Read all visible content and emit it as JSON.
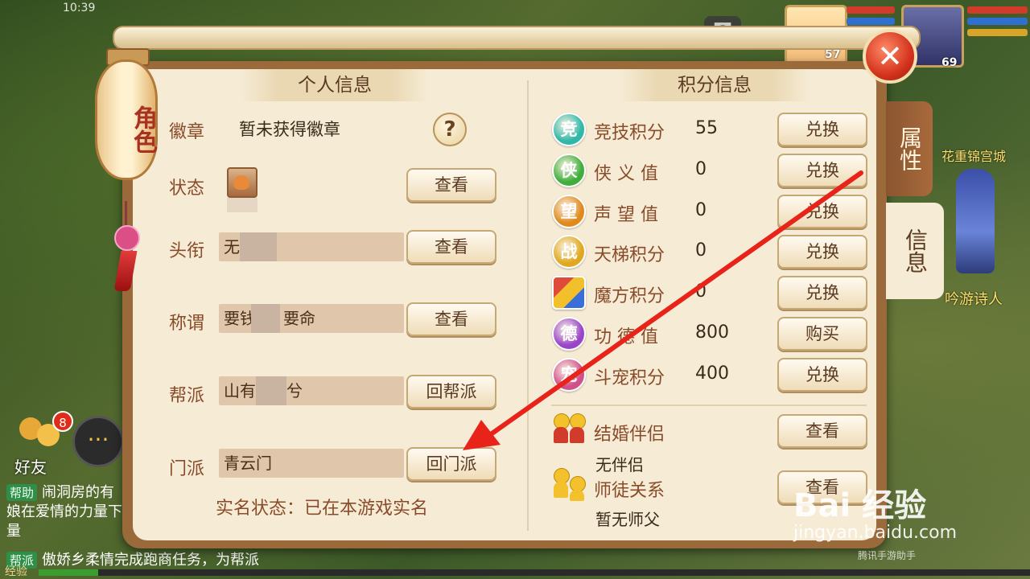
{
  "status_time": "10:39",
  "hud": {
    "avatar_level_1": "57",
    "avatar_level_2": "69",
    "npc_name_1": "花重锦宫城",
    "npc_name_2": "吟游诗人"
  },
  "lantern_label": "角色",
  "close_label": "✕",
  "tabs": {
    "attributes": "属性",
    "info": "信息"
  },
  "personal": {
    "header": "个人信息",
    "badge_label": "徽章",
    "badge_value": "暂未获得徽章",
    "help": "?",
    "status_label": "状态",
    "title_label": "头衔",
    "title_value": "无",
    "appellation_label": "称谓",
    "appellation_value_a": "要钱",
    "appellation_value_b": "要命",
    "guild_label": "帮派",
    "guild_value_a": "山有",
    "guild_value_b": "兮",
    "sect_label": "门派",
    "sect_value": "青云门",
    "view_label": "查看",
    "return_guild_label": "回帮派",
    "return_sect_label": "回门派",
    "realname": "实名状态：已在本游戏实名"
  },
  "points": {
    "header": "积分信息",
    "items": [
      {
        "icon": "竞",
        "label": "竞技积分",
        "value": "55",
        "button": "兑换",
        "color": "#2fb8a8"
      },
      {
        "icon": "侠",
        "label": "侠 义 值",
        "value": "0",
        "button": "兑换",
        "color": "#3fae3a"
      },
      {
        "icon": "望",
        "label": "声 望 值",
        "value": "0",
        "button": "兑换",
        "color": "#e08a1e"
      },
      {
        "icon": "战",
        "label": "天梯积分",
        "value": "0",
        "button": "兑换",
        "color": "#e0a81e"
      },
      {
        "icon": "",
        "label": "魔方积分",
        "value": "0",
        "button": "兑换",
        "color": "#c0502a"
      },
      {
        "icon": "德",
        "label": "功 德 值",
        "value": "800",
        "button": "购买",
        "color": "#9a45c8"
      },
      {
        "icon": "宠",
        "label": "斗宠积分",
        "value": "400",
        "button": "兑换",
        "color": "#d0508a"
      }
    ],
    "marriage_label": "结婚伴侣",
    "marriage_status": "无伴侣",
    "mentor_label": "师徒关系",
    "mentor_status": "暂无师父",
    "view_label": "查看"
  },
  "friends": {
    "label": "好友",
    "badge": "8"
  },
  "chat": {
    "button": "···",
    "lines": [
      {
        "tag": "帮助",
        "text": "闹洞房的有"
      },
      {
        "tag": "",
        "text": "娘在爱情的力量下"
      },
      {
        "tag": "",
        "text": "量"
      },
      {
        "tag": "帮派",
        "text": "傲娇乡柔情完成跑商任务，为帮派"
      }
    ]
  },
  "exp_label": "经验",
  "exp_fraction": 0.06,
  "watermark": {
    "brand": "Bai 经验",
    "url": "jingyan.baidu.com",
    "assist": "腾讯手游助手"
  }
}
